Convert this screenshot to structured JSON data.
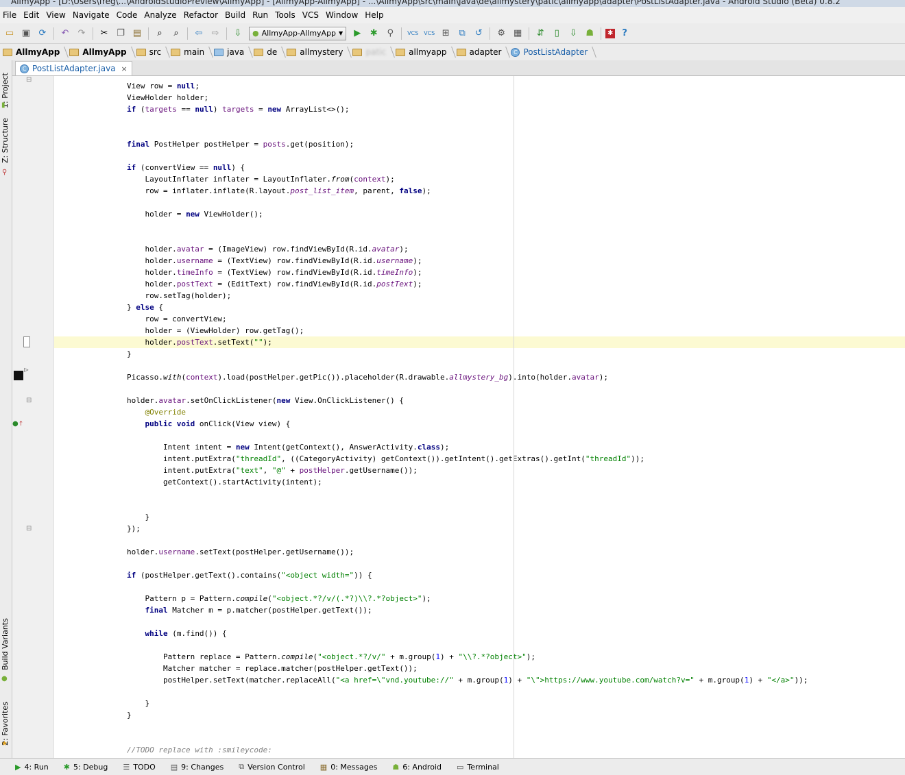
{
  "window": {
    "title": "AllmyApp - [D:\\Users\\freg\\...\\AndroidStudioPreview\\AllmyApp] - [AllmyApp-AllmyApp] - ...\\AllmyApp\\src\\main\\java\\de\\allmystery\\patic\\allmyapp\\adapter\\PostListAdapter.java - Android Studio (Beta) 0.8.2"
  },
  "menu": [
    "File",
    "Edit",
    "View",
    "Navigate",
    "Code",
    "Analyze",
    "Refactor",
    "Build",
    "Run",
    "Tools",
    "VCS",
    "Window",
    "Help"
  ],
  "toolbar": {
    "run_config": "AllmyApp-AllmyApp"
  },
  "breadcrumbs": [
    "AllmyApp",
    "AllmyApp",
    "src",
    "main",
    "java",
    "de",
    "allmystery",
    "patic",
    "allmyapp",
    "adapter",
    "PostListAdapter"
  ],
  "tab": {
    "label": "PostListAdapter.java",
    "close": "×"
  },
  "side_tabs": {
    "project": "1: Project",
    "structure": "Z: Structure",
    "build_variants": "Build Variants",
    "favorites": "2: Favorites"
  },
  "status_tools": [
    "4: Run",
    "5: Debug",
    "TODO",
    "9: Changes",
    "Version Control",
    "0: Messages",
    "6: Android",
    "Terminal"
  ]
}
